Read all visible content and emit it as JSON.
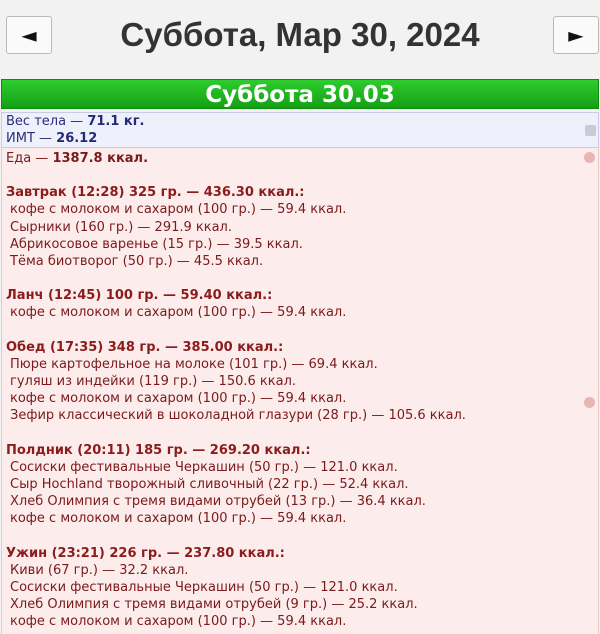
{
  "header": {
    "prev_label": "◄",
    "next_label": "►",
    "date_title": "Суббота, Мар 30, 2024"
  },
  "day": {
    "title": "Суббота 30.03"
  },
  "stats": {
    "weight_label": "Вес тела — ",
    "weight_value": "71.1 кг.",
    "bmi_label": "ИМТ — ",
    "bmi_value": "26.12"
  },
  "food_total": {
    "label": "Еда — ",
    "value": "1387.8 ккал."
  },
  "meals": [
    {
      "title": "Завтрак (12:28) 325 гр. — 436.30 ккал.:",
      "items": [
        "кофе с молоком и сахаром (100 гр.) — 59.4 ккал.",
        "Сырники (160 гр.) — 291.9 ккал.",
        "Абрикосовое варенье (15 гр.) — 39.5 ккал.",
        "Тёма биотворог (50 гр.) — 45.5 ккал."
      ]
    },
    {
      "title": "Ланч (12:45) 100 гр. — 59.40 ккал.:",
      "items": [
        "кофе с молоком и сахаром (100 гр.) — 59.4 ккал."
      ]
    },
    {
      "title": "Обед (17:35) 348 гр. — 385.00 ккал.:",
      "items": [
        "Пюре картофельное на молоке (101 гр.) — 69.4 ккал.",
        "гуляш из индейки (119 гр.) — 150.6 ккал.",
        "кофе с молоком и сахаром (100 гр.) — 59.4 ккал.",
        "Зефир классический в шоколадной глазури (28 гр.) — 105.6 ккал."
      ]
    },
    {
      "title": "Полдник (20:11) 185 гр. — 269.20 ккал.:",
      "items": [
        "Сосиски фестивальные Черкашин (50 гр.) — 121.0 ккал.",
        "Сыр Hochland творожный сливочный (22 гр.) — 52.4 ккал.",
        "Хлеб Олимпия с тремя видами отрубей (13 гр.) — 36.4 ккал.",
        "кофе с молоком и сахаром (100 гр.) — 59.4 ккал."
      ]
    },
    {
      "title": "Ужин (23:21) 226 гр. — 237.80 ккал.:",
      "items": [
        "Киви (67 гр.) — 32.2 ккал.",
        "Сосиски фестивальные Черкашин (50 гр.) — 121.0 ккал.",
        "Хлеб Олимпия с тремя видами отрубей (9 гр.) — 25.2 ккал.",
        "кофе с молоком и сахаром (100 гр.) — 59.4 ккал."
      ]
    }
  ]
}
